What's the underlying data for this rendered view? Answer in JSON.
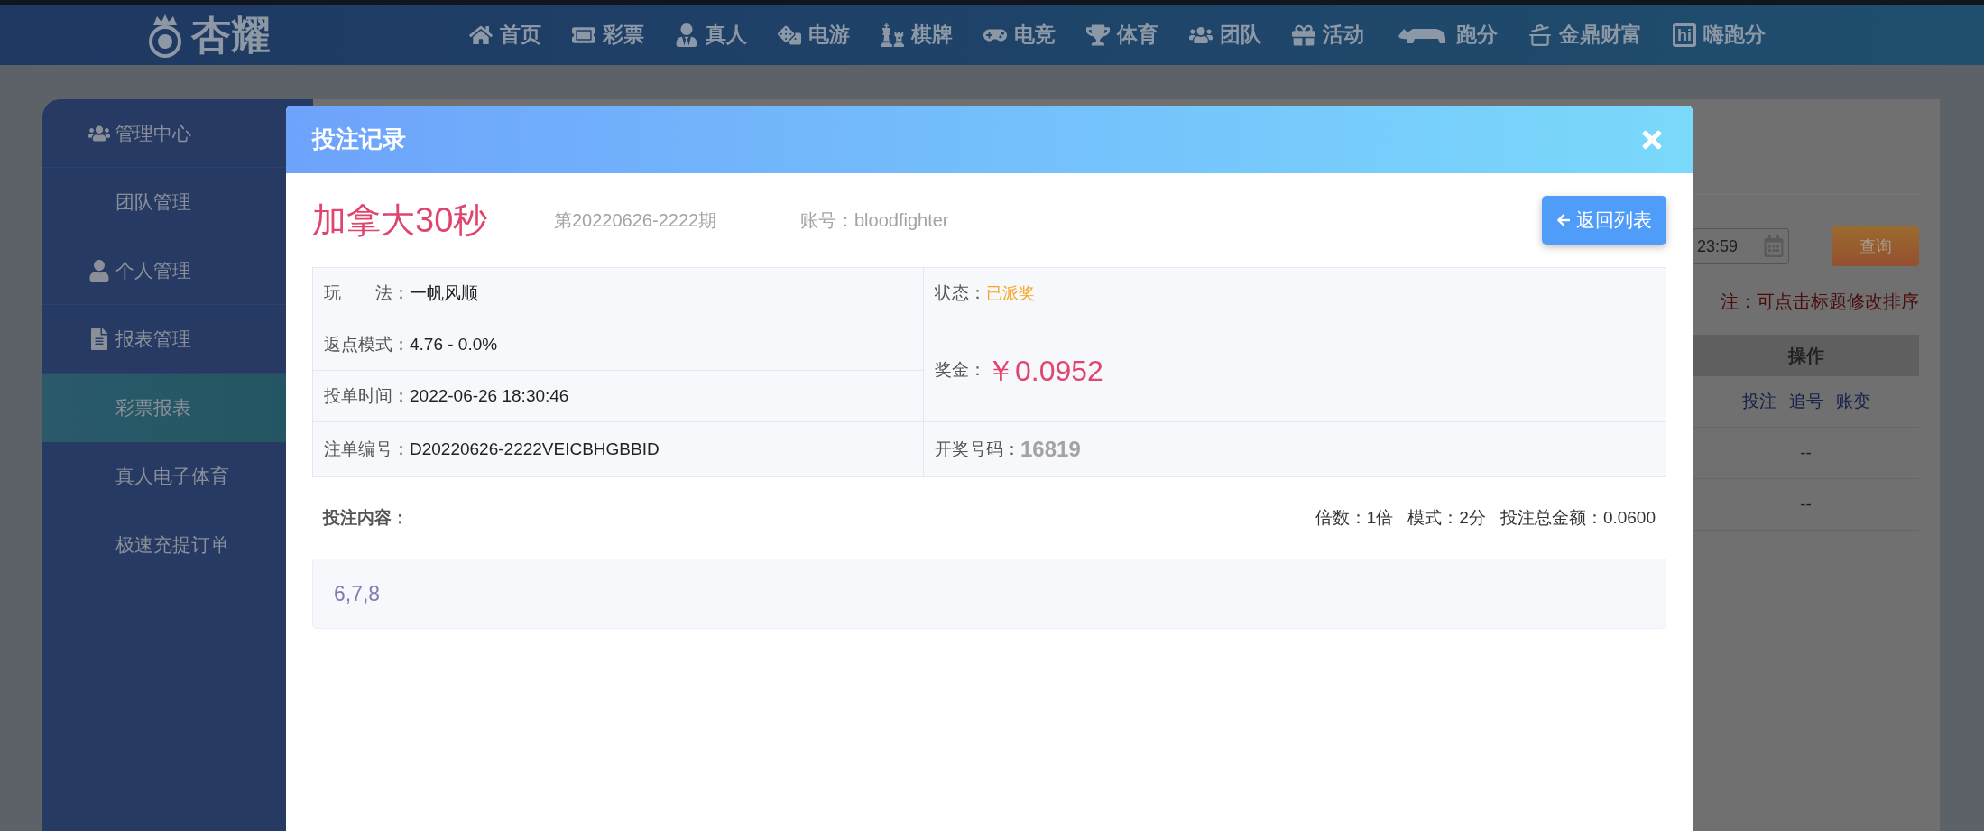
{
  "nav": {
    "logo": "杏耀",
    "items": [
      {
        "label": "首页"
      },
      {
        "label": "彩票"
      },
      {
        "label": "真人"
      },
      {
        "label": "电游"
      },
      {
        "label": "棋牌"
      },
      {
        "label": "电竞"
      },
      {
        "label": "体育"
      },
      {
        "label": "团队"
      },
      {
        "label": "活动"
      },
      {
        "label": "跑分"
      },
      {
        "label": "金鼎财富"
      },
      {
        "label": "嗨跑分",
        "badge": "hi"
      }
    ]
  },
  "sidebar": {
    "items": [
      {
        "label": "管理中心",
        "kind": "group",
        "selected": false
      },
      {
        "label": "团队管理",
        "kind": "link",
        "selected": false
      },
      {
        "label": "个人管理",
        "kind": "group",
        "selected": false
      },
      {
        "label": "报表管理",
        "kind": "group",
        "selected": false
      },
      {
        "label": "彩票报表",
        "kind": "link",
        "selected": true
      },
      {
        "label": "真人电子体育",
        "kind": "link",
        "selected": false
      },
      {
        "label": "极速充提订单",
        "kind": "link",
        "selected": false
      }
    ]
  },
  "page": {
    "date_value": "23:59",
    "query_button": "查询",
    "note": "注：可点击标题修改排序",
    "table": {
      "columns": [
        "操作"
      ],
      "rows": [
        {
          "actions": [
            "投注",
            "追号",
            "账变"
          ]
        },
        {
          "value": "--"
        },
        {
          "value": "--"
        }
      ]
    }
  },
  "modal": {
    "title": "投注记录",
    "lottery": "加拿大30秒",
    "issue": "第20220626-2222期",
    "account": "账号：bloodfighter",
    "back_button": "返回列表",
    "details_left": [
      {
        "label": "玩　　法：",
        "value": "一帆风顺"
      },
      {
        "label": "返点模式：",
        "value": "4.76 - 0.0%"
      },
      {
        "label": "投单时间：",
        "value": "2022-06-26 18:30:46"
      },
      {
        "label": "注单编号：",
        "value": "D20220626-2222VEICBHGBBID"
      }
    ],
    "details_right": [
      {
        "label": "状态：",
        "value": "已派奖",
        "kind": "status"
      },
      {
        "label": "奖金：",
        "value": "￥0.0952",
        "kind": "amount"
      },
      {
        "label": "开奖号码：",
        "value": "16819",
        "kind": "number"
      }
    ],
    "content_label": "投注内容：",
    "summary": [
      "倍数：1倍",
      "模式：2分",
      "投注总金额：0.0600"
    ],
    "content": "6,7,8"
  }
}
